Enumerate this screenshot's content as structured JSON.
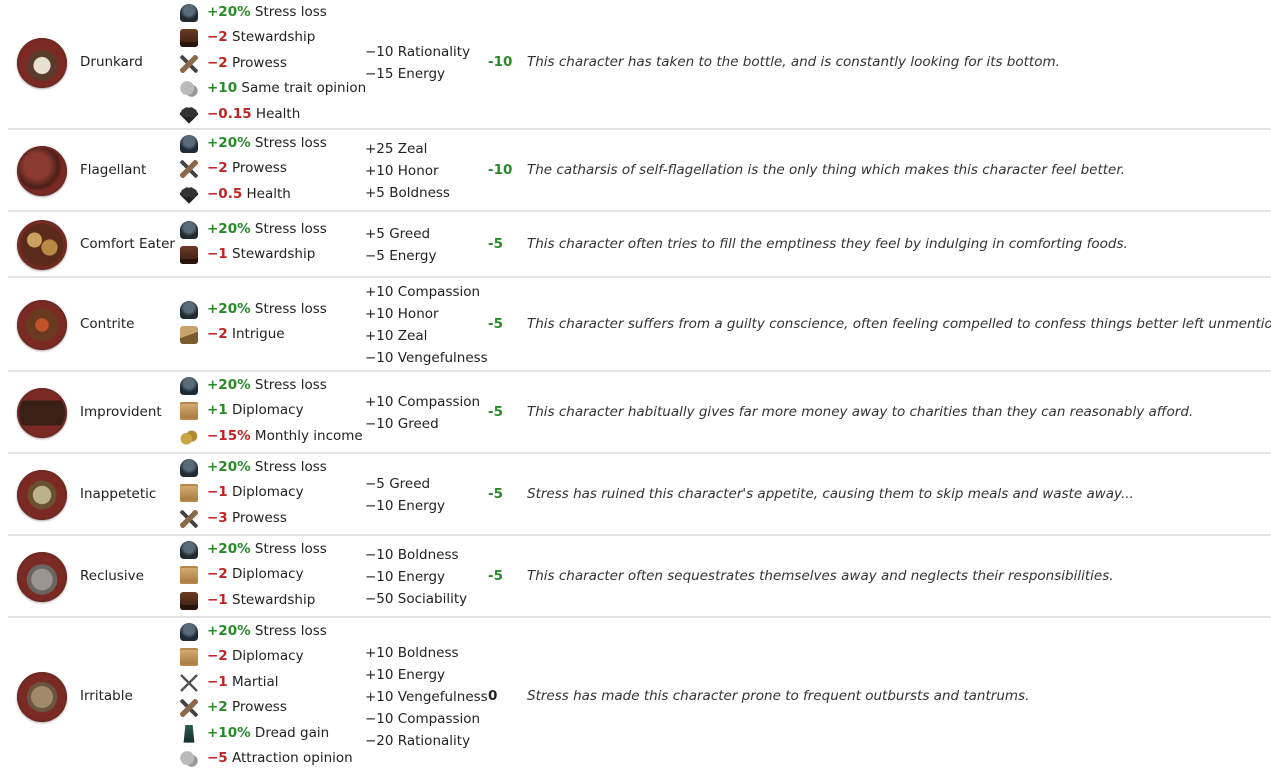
{
  "rows": [
    {
      "name": "Drunkard",
      "portrait": "beer-mug-portrait",
      "effects": [
        {
          "icon": "stress-icon",
          "value": "+20%",
          "sign": "pos",
          "label": "Stress loss"
        },
        {
          "icon": "stewardship-icon",
          "value": "−2",
          "sign": "neg",
          "label": "Stewardship"
        },
        {
          "icon": "prowess-icon",
          "value": "−2",
          "sign": "neg",
          "label": "Prowess"
        },
        {
          "icon": "opinion-icon",
          "value": "+10",
          "sign": "pos",
          "label": "Same trait opinion"
        },
        {
          "icon": "health-icon",
          "value": "−0.15",
          "sign": "neg",
          "label": "Health"
        }
      ],
      "personality": [
        "−10 Rationality",
        "−15 Energy"
      ],
      "opinion": "-10",
      "description": "This character has taken to the bottle, and is constantly looking for its bottom."
    },
    {
      "name": "Flagellant",
      "portrait": "whip-portrait",
      "effects": [
        {
          "icon": "stress-icon",
          "value": "+20%",
          "sign": "pos",
          "label": "Stress loss"
        },
        {
          "icon": "prowess-icon",
          "value": "−2",
          "sign": "neg",
          "label": "Prowess"
        },
        {
          "icon": "health-icon",
          "value": "−0.5",
          "sign": "neg",
          "label": "Health"
        }
      ],
      "personality": [
        "+25 Zeal",
        "+10 Honor",
        "+5 Boldness"
      ],
      "opinion": "-10",
      "description": "The catharsis of self-flagellation is the only thing which makes this character feel better."
    },
    {
      "name": "Comfort Eater",
      "portrait": "cookies-portrait",
      "effects": [
        {
          "icon": "stress-icon",
          "value": "+20%",
          "sign": "pos",
          "label": "Stress loss"
        },
        {
          "icon": "stewardship-icon",
          "value": "−1",
          "sign": "neg",
          "label": "Stewardship"
        }
      ],
      "personality": [
        "+5 Greed",
        "−5 Energy"
      ],
      "opinion": "-5",
      "description": "This character often tries to fill the emptiness they feel by indulging in comforting foods."
    },
    {
      "name": "Contrite",
      "portrait": "confessional-portrait",
      "effects": [
        {
          "icon": "stress-icon",
          "value": "+20%",
          "sign": "pos",
          "label": "Stress loss"
        },
        {
          "icon": "intrigue-icon",
          "value": "−2",
          "sign": "neg",
          "label": "Intrigue"
        }
      ],
      "personality": [
        "+10 Compassion",
        "+10 Honor",
        "+10 Zeal",
        "−10 Vengefulness"
      ],
      "opinion": "-5",
      "description": "This character suffers from a guilty conscience, often feeling compelled to confess things better left unmentioned."
    },
    {
      "name": "Improvident",
      "portrait": "chest-portrait",
      "effects": [
        {
          "icon": "stress-icon",
          "value": "+20%",
          "sign": "pos",
          "label": "Stress loss"
        },
        {
          "icon": "diplomacy-icon",
          "value": "+1",
          "sign": "pos",
          "label": "Diplomacy"
        },
        {
          "icon": "income-icon",
          "value": "−15%",
          "sign": "neg",
          "label": "Monthly income"
        }
      ],
      "personality": [
        "+10 Compassion",
        "−10 Greed"
      ],
      "opinion": "-5",
      "description": "This character habitually gives far more money away to charities than they can reasonably afford."
    },
    {
      "name": "Inappetetic",
      "portrait": "empty-plate-portrait",
      "effects": [
        {
          "icon": "stress-icon",
          "value": "+20%",
          "sign": "pos",
          "label": "Stress loss"
        },
        {
          "icon": "diplomacy-icon",
          "value": "−1",
          "sign": "neg",
          "label": "Diplomacy"
        },
        {
          "icon": "prowess-icon",
          "value": "−3",
          "sign": "neg",
          "label": "Prowess"
        }
      ],
      "personality": [
        "−5 Greed",
        "−10 Energy"
      ],
      "opinion": "-5",
      "description": "Stress has ruined this character's appetite, causing them to skip meals and waste away..."
    },
    {
      "name": "Reclusive",
      "portrait": "hermit-hut-portrait",
      "effects": [
        {
          "icon": "stress-icon",
          "value": "+20%",
          "sign": "pos",
          "label": "Stress loss"
        },
        {
          "icon": "diplomacy-icon",
          "value": "−2",
          "sign": "neg",
          "label": "Diplomacy"
        },
        {
          "icon": "stewardship-icon",
          "value": "−1",
          "sign": "neg",
          "label": "Stewardship"
        }
      ],
      "personality": [
        "−10 Boldness",
        "−10 Energy",
        "−50 Sociability"
      ],
      "opinion": "-5",
      "description": "This character often sequestrates themselves away and neglects their responsibilities."
    },
    {
      "name": "Irritable",
      "portrait": "hornet-nest-portrait",
      "effects": [
        {
          "icon": "stress-icon",
          "value": "+20%",
          "sign": "pos",
          "label": "Stress loss"
        },
        {
          "icon": "diplomacy-icon",
          "value": "−2",
          "sign": "neg",
          "label": "Diplomacy"
        },
        {
          "icon": "martial-icon",
          "value": "−1",
          "sign": "neg",
          "label": "Martial"
        },
        {
          "icon": "prowess-icon",
          "value": "+2",
          "sign": "pos",
          "label": "Prowess"
        },
        {
          "icon": "dread-icon",
          "value": "+10%",
          "sign": "pos",
          "label": "Dread gain"
        },
        {
          "icon": "opinion-icon",
          "value": "−5",
          "sign": "neg",
          "label": "Attraction opinion"
        }
      ],
      "personality": [
        "+10 Boldness",
        "+10 Energy",
        "+10 Vengefulness",
        "−10 Compassion",
        "−20 Rationality"
      ],
      "opinion": "0",
      "description": "Stress has made this character prone to frequent outbursts and tantrums."
    }
  ]
}
